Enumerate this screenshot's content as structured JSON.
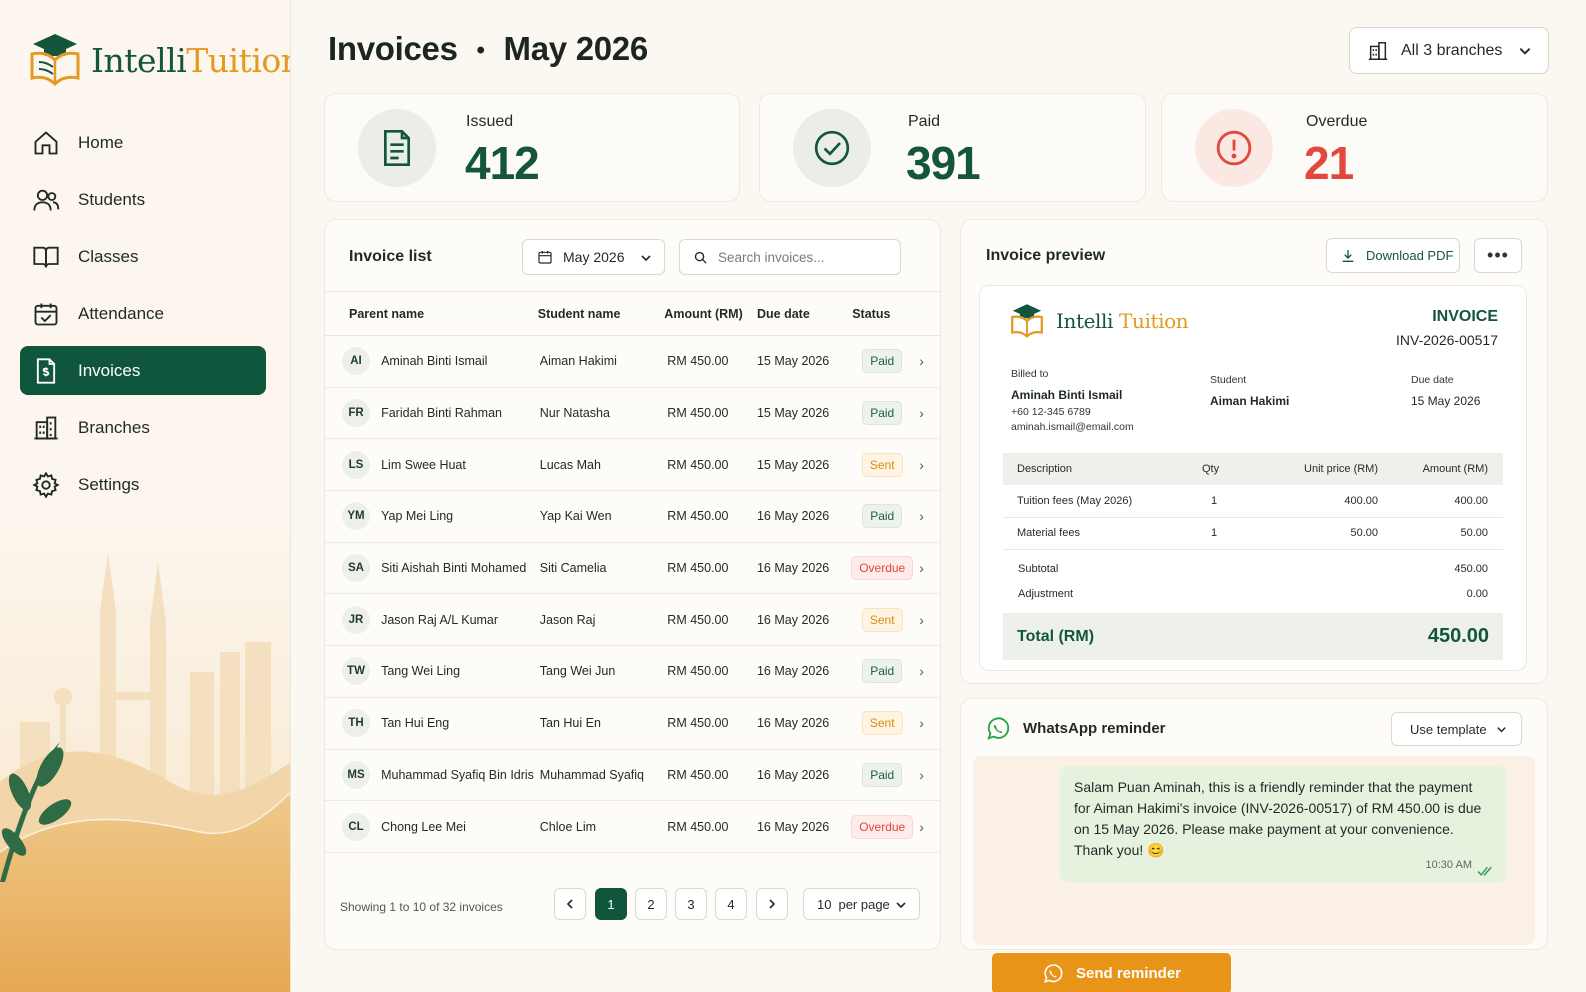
{
  "brand": {
    "name_part1": "Intelli",
    "name_part2": "Tuition"
  },
  "sidebar": {
    "items": [
      {
        "label": "Home",
        "icon": "home-icon"
      },
      {
        "label": "Students",
        "icon": "users-icon"
      },
      {
        "label": "Classes",
        "icon": "book-icon"
      },
      {
        "label": "Attendance",
        "icon": "calendar-check-icon"
      },
      {
        "label": "Invoices",
        "icon": "invoice-icon",
        "active": true
      },
      {
        "label": "Branches",
        "icon": "building-icon"
      },
      {
        "label": "Settings",
        "icon": "gear-icon"
      }
    ]
  },
  "header": {
    "title": "Invoices",
    "separator": "•",
    "period": "May 2026",
    "branch_select": "All 3 branches"
  },
  "stats": {
    "issued": {
      "label": "Issued",
      "value": "412"
    },
    "paid": {
      "label": "Paid",
      "value": "391"
    },
    "overdue": {
      "label": "Overdue",
      "value": "21"
    }
  },
  "invoice_list": {
    "title": "Invoice list",
    "month": "May 2026",
    "search_placeholder": "Search invoices...",
    "columns": [
      "Parent name",
      "Student name",
      "Amount (RM)",
      "Due date",
      "Status"
    ],
    "rows": [
      {
        "initials": "AI",
        "parent": "Aminah Binti Ismail",
        "student": "Aiman Hakimi",
        "amount": "RM 450.00",
        "due": "15 May 2026",
        "status": "Paid"
      },
      {
        "initials": "FR",
        "parent": "Faridah Binti Rahman",
        "student": "Nur Natasha",
        "amount": "RM 450.00",
        "due": "15 May 2026",
        "status": "Paid"
      },
      {
        "initials": "LS",
        "parent": "Lim Swee Huat",
        "student": "Lucas Mah",
        "amount": "RM 450.00",
        "due": "15 May 2026",
        "status": "Sent"
      },
      {
        "initials": "YM",
        "parent": "Yap Mei Ling",
        "student": "Yap Kai Wen",
        "amount": "RM 450.00",
        "due": "16 May 2026",
        "status": "Paid"
      },
      {
        "initials": "SA",
        "parent": "Siti Aishah Binti Mohamed",
        "student": "Siti Camelia",
        "amount": "RM 450.00",
        "due": "16 May 2026",
        "status": "Overdue"
      },
      {
        "initials": "JR",
        "parent": "Jason Raj A/L Kumar",
        "student": "Jason Raj",
        "amount": "RM 450.00",
        "due": "16 May 2026",
        "status": "Sent"
      },
      {
        "initials": "TW",
        "parent": "Tang Wei Ling",
        "student": "Tang Wei Jun",
        "amount": "RM 450.00",
        "due": "16 May 2026",
        "status": "Paid"
      },
      {
        "initials": "TH",
        "parent": "Tan Hui Eng",
        "student": "Tan Hui En",
        "amount": "RM 450.00",
        "due": "16 May 2026",
        "status": "Sent"
      },
      {
        "initials": "MS",
        "parent": "Muhammad Syafiq Bin Idris",
        "student": "Muhammad Syafiq",
        "amount": "RM 450.00",
        "due": "16 May 2026",
        "status": "Paid"
      },
      {
        "initials": "CL",
        "parent": "Chong Lee Mei",
        "student": "Chloe Lim",
        "amount": "RM 450.00",
        "due": "16 May 2026",
        "status": "Overdue"
      }
    ],
    "pagination": {
      "summary": "Showing 1 to 10 of 32 invoices",
      "pages": [
        "1",
        "2",
        "3",
        "4"
      ],
      "current": "1",
      "per_page_value": "10",
      "per_page_label": "per page"
    }
  },
  "preview": {
    "title": "Invoice preview",
    "download_label": "Download PDF",
    "more_label": "•••",
    "doc": {
      "heading": "INVOICE",
      "number": "INV-2026-00517",
      "billed_to_label": "Billed to",
      "parent_name": "Aminah Binti Ismail",
      "phone": "+60 12-345 6789",
      "email": "aminah.ismail@email.com",
      "student_label": "Student",
      "student_name": "Aiman Hakimi",
      "due_label": "Due date",
      "due_value": "15 May 2026",
      "columns": [
        "Description",
        "Qty",
        "Unit price (RM)",
        "Amount (RM)"
      ],
      "items": [
        {
          "desc": "Tuition fees (May 2026)",
          "qty": "1",
          "unit": "400.00",
          "amount": "400.00"
        },
        {
          "desc": "Material fees",
          "qty": "1",
          "unit": "50.00",
          "amount": "50.00"
        }
      ],
      "subtotal_label": "Subtotal",
      "subtotal": "450.00",
      "adjustment_label": "Adjustment",
      "adjustment": "0.00",
      "total_label": "Total (RM)",
      "total": "450.00"
    }
  },
  "whatsapp": {
    "title": "WhatsApp reminder",
    "template_label": "Use template",
    "message": "Salam Puan Aminah, this is a friendly reminder that the payment for Aiman Hakimi's invoice (INV-2026-00517) of RM 450.00 is due on 15 May 2026. Please make payment at your convenience. Thank you! 😊",
    "time": "10:30 AM",
    "send_label": "Send reminder"
  },
  "colors": {
    "brand_green": "#10563c",
    "brand_orange": "#e89418",
    "overdue_red": "#e0493b",
    "sent_amber": "#d98a14"
  }
}
